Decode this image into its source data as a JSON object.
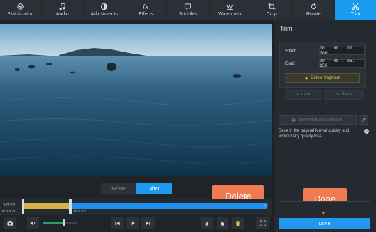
{
  "toolbar": {
    "items": [
      {
        "label": "Stabilization",
        "icon": "stabilization-icon"
      },
      {
        "label": "Audio",
        "icon": "music-note-icon"
      },
      {
        "label": "Adjustments",
        "icon": "adjustments-icon"
      },
      {
        "label": "Effects",
        "icon": "effects-fx-icon"
      },
      {
        "label": "Subtitles",
        "icon": "subtitles-icon"
      },
      {
        "label": "Watermark",
        "icon": "watermark-icon"
      },
      {
        "label": "Crop",
        "icon": "crop-icon"
      },
      {
        "label": "Rotate",
        "icon": "rotate-icon"
      },
      {
        "label": "Trim",
        "icon": "scissors-icon",
        "active": true
      }
    ]
  },
  "preview": {
    "before_label": "Before",
    "after_label": "After"
  },
  "timeline": {
    "current_time_top": "0:00:05",
    "current_time_bottom": "0:00:05",
    "left_time_bottom": "0:00:03",
    "end_time": "24"
  },
  "panel": {
    "title": "Trim",
    "start_label": "Start:",
    "start_value": "00 : 00 : 00. 000",
    "end_label": "End:",
    "end_value": "00 : 00 : 05. 150",
    "delete_fragment": "Delete fragment",
    "undo": "Undo",
    "redo": "Redo",
    "save_without_conversion": "Save without conversion",
    "save_desc": "Save in the original format quickly and without any quality loss.",
    "help": "?",
    "done": "Done"
  },
  "callouts": {
    "delete": "Delete",
    "done": "Done"
  },
  "colors": {
    "accent": "#1f99ee",
    "callout": "#f07a52",
    "selection": "#d7b24a"
  },
  "volume": {
    "level": 0.62
  }
}
